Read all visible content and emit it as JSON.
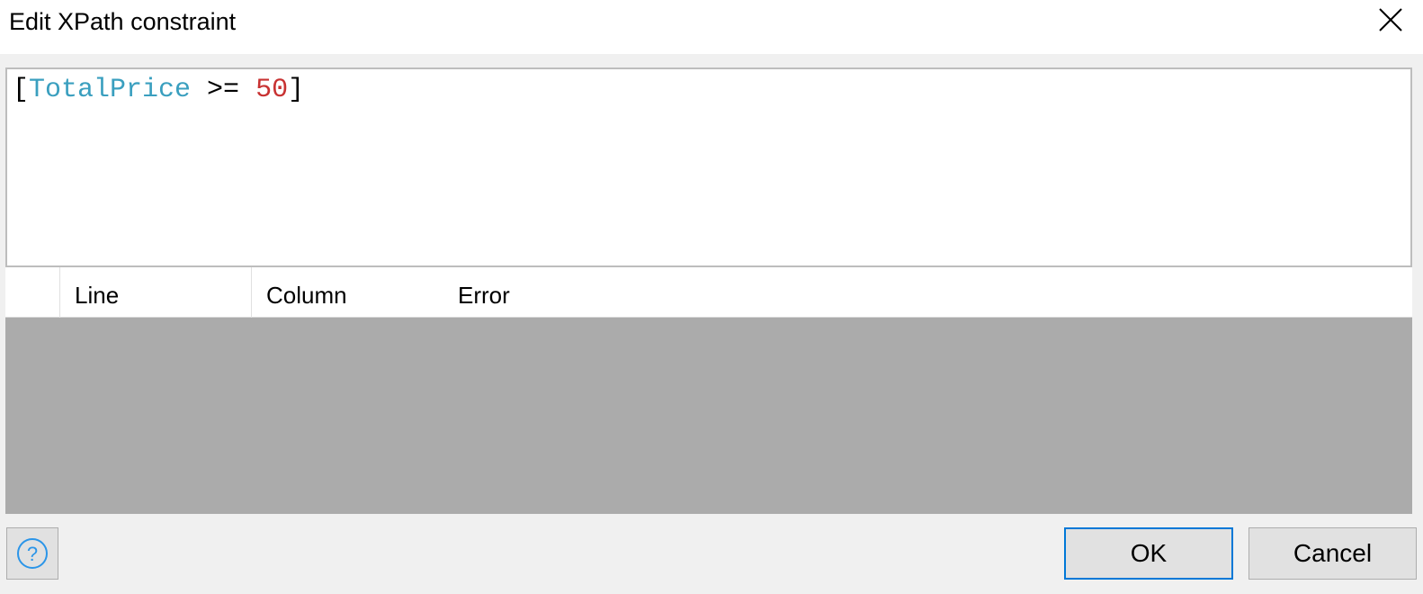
{
  "dialog": {
    "title": "Edit XPath constraint"
  },
  "editor": {
    "tokens": {
      "open": "[",
      "attribute": "TotalPrice",
      "operator": " >= ",
      "value": "50",
      "close": "]"
    }
  },
  "errors": {
    "columns": {
      "line": "Line",
      "column": "Column",
      "error": "Error"
    },
    "rows": []
  },
  "footer": {
    "help_icon": "question-circle-icon",
    "ok_label": "OK",
    "cancel_label": "Cancel"
  },
  "colors": {
    "attribute": "#3a9fbf",
    "number": "#c83232",
    "ok_border": "#0078d7",
    "help_icon": "#2b95e8",
    "error_list_bg": "#ababab"
  }
}
